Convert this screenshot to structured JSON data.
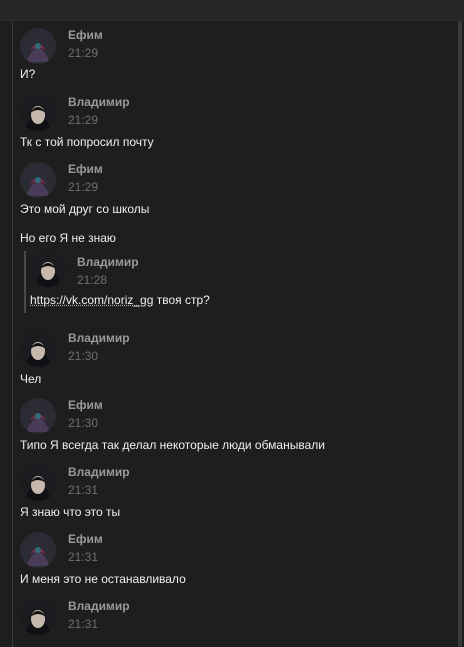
{
  "messages": [
    {
      "author": "Ефим",
      "time": "21:29",
      "avatar": "efim-avatar",
      "lines": [
        "И?"
      ]
    },
    {
      "author": "Владимир",
      "time": "21:29",
      "avatar": "vladimir-avatar",
      "lines": [
        "Тк с той попросил почту"
      ]
    },
    {
      "author": "Ефим",
      "time": "21:29",
      "avatar": "efim-avatar",
      "lines": [
        "Это мой друг со школы",
        "Но его Я не знаю"
      ]
    },
    {
      "author": "Владимир",
      "time": "21:30",
      "avatar": "vladimir-avatar",
      "lines": [
        "Чел"
      ]
    },
    {
      "author": "Ефим",
      "time": "21:30",
      "avatar": "efim-avatar",
      "lines": [
        "Типо Я всегда так делал некоторые люди обманывали"
      ]
    },
    {
      "author": "Владимир",
      "time": "21:31",
      "avatar": "vladimir-avatar",
      "lines": [
        "Я знаю что это ты"
      ]
    },
    {
      "author": "Ефим",
      "time": "21:31",
      "avatar": "efim-avatar",
      "lines": [
        "И меня это не останавливало"
      ]
    },
    {
      "author": "Владимир",
      "time": "21:31",
      "avatar": "vladimir-avatar",
      "lines": []
    }
  ],
  "quote": {
    "author": "Владимир",
    "time": "21:28",
    "link_text": "https://vk.com/noriz_gg",
    "text": " твоя стр?"
  },
  "colors": {
    "background": "#1e1e1e",
    "author": "#9a9a9a",
    "time": "#6f6f6f",
    "text": "#f0f0f0"
  }
}
